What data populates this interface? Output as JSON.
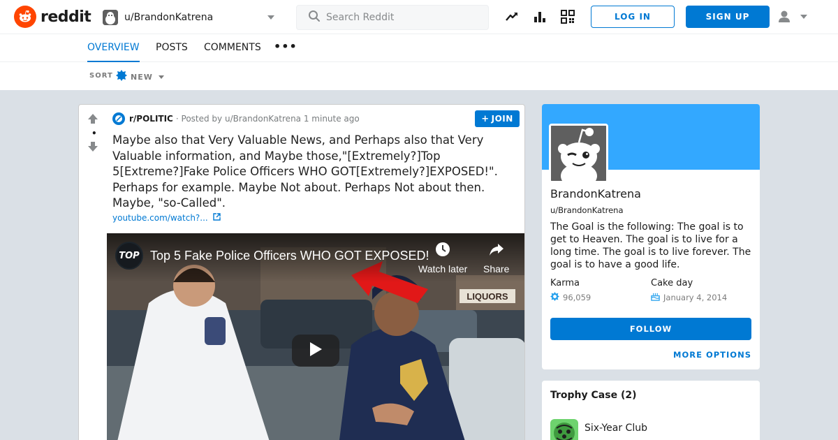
{
  "header": {
    "brand": "reddit",
    "user_switcher": "u/BrandonKatrena",
    "search_placeholder": "Search Reddit",
    "login_label": "LOG IN",
    "signup_label": "SIGN UP"
  },
  "tabs": {
    "items": [
      {
        "label": "OVERVIEW",
        "active": true
      },
      {
        "label": "POSTS",
        "active": false
      },
      {
        "label": "COMMENTS",
        "active": false
      }
    ],
    "more": "•••"
  },
  "sort": {
    "label": "SORT",
    "value": "NEW"
  },
  "post": {
    "vote_count": "•",
    "subreddit": "r/POLITIC",
    "posted_by": "· Posted by u/BrandonKatrena 1 minute ago",
    "join_label": "JOIN",
    "title": "Maybe also that Very Valuable News, and Perhaps also that Very Valuable information, and Maybe those,\"[Extremely?]Top 5[Extreme?]Fake Police Officers WHO GOT[Extremely?]EXPOSED!\". Perhaps for example. Maybe Not about. Perhaps Not about then. Maybe, \"so-Called\".",
    "link_text": "youtube.com/watch?...",
    "video": {
      "channel_logo_text": "TOP",
      "title": "Top 5 Fake Police Officers WHO GOT EXPOSED!",
      "watch_later": "Watch later",
      "share": "Share",
      "sign_text": "LIQUORS"
    }
  },
  "profile": {
    "display_name": "BrandonKatrena",
    "handle": "u/BrandonKatrena",
    "bio": "The Goal is the following: The goal is to get to Heaven. The goal is to live for a long time. The goal is to live forever. The goal is to have a good life.",
    "karma_label": "Karma",
    "karma_value": "96,059",
    "cakeday_label": "Cake day",
    "cakeday_value": "January 4, 2014",
    "follow_label": "FOLLOW",
    "more_options_label": "MORE OPTIONS"
  },
  "trophy_case": {
    "title": "Trophy Case (2)",
    "items": [
      {
        "name": "Six-Year Club"
      }
    ]
  },
  "colors": {
    "brand_orange": "#ff4500",
    "accent_blue": "#0079d3",
    "banner_blue": "#33a8ff",
    "page_bg": "#dae0e6"
  }
}
